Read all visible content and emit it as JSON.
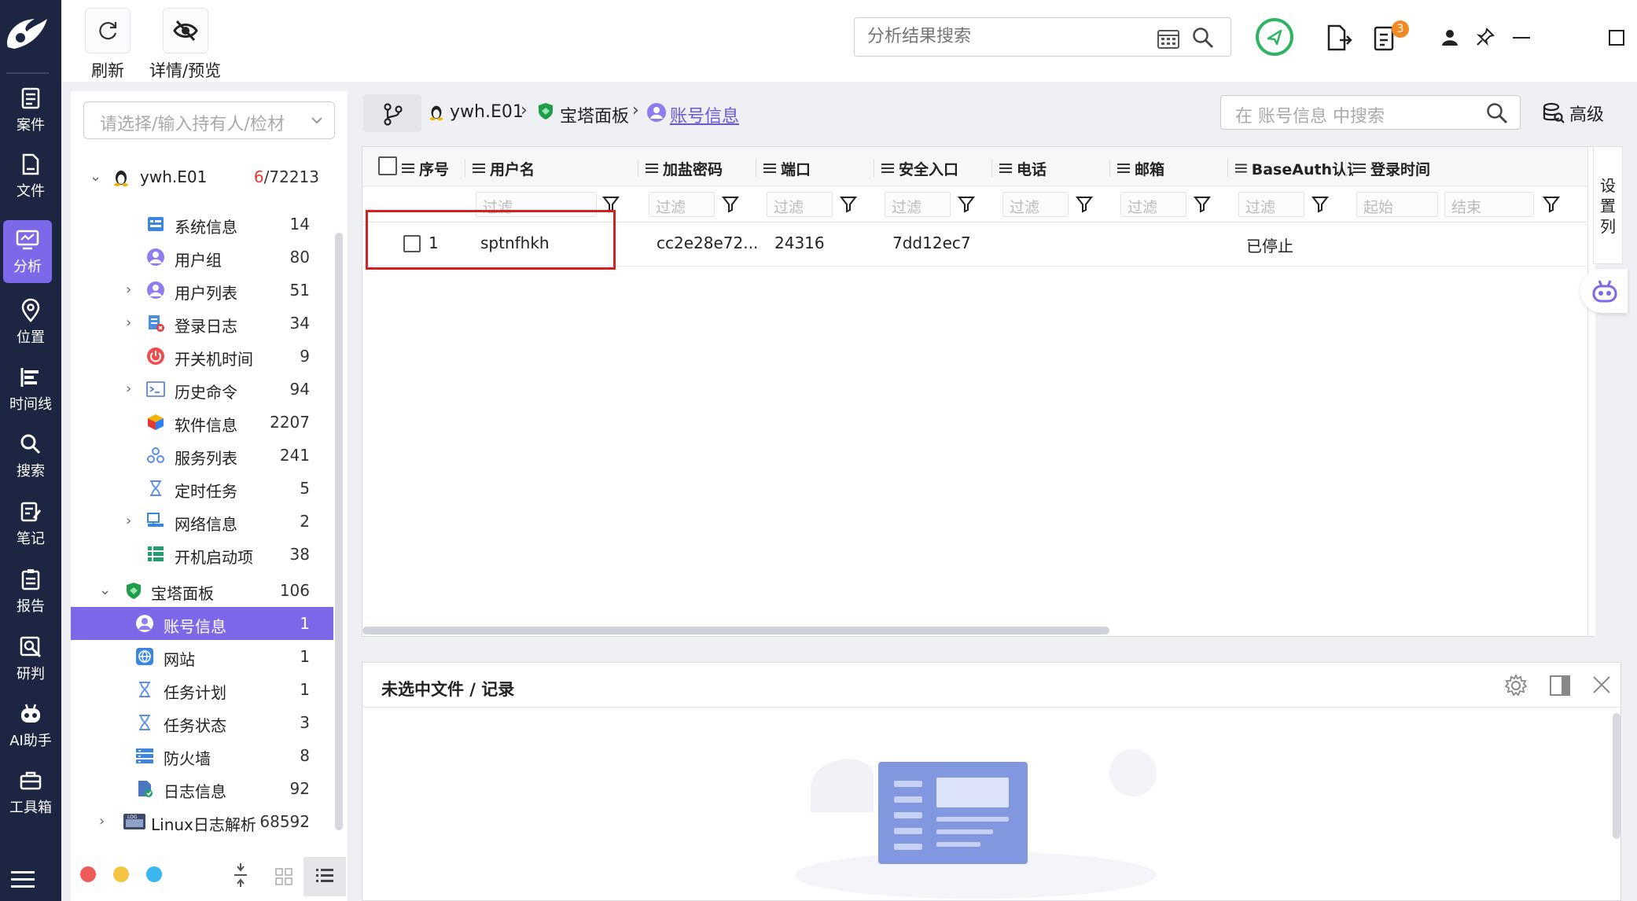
{
  "toolbar": {
    "refresh_label": "刷新",
    "details_label": "详情/预览",
    "search_placeholder": "分析结果搜索",
    "notification_count": "3"
  },
  "rail": {
    "items": [
      {
        "label": "案件",
        "icon": "case-icon"
      },
      {
        "label": "文件",
        "icon": "file-icon"
      },
      {
        "label": "分析",
        "icon": "analysis-icon"
      },
      {
        "label": "位置",
        "icon": "location-icon"
      },
      {
        "label": "时间线",
        "icon": "timeline-icon"
      },
      {
        "label": "搜索",
        "icon": "search-icon"
      },
      {
        "label": "笔记",
        "icon": "note-icon"
      },
      {
        "label": "报告",
        "icon": "report-icon"
      },
      {
        "label": "研判",
        "icon": "judge-icon"
      },
      {
        "label": "AI助手",
        "icon": "ai-icon"
      },
      {
        "label": "工具箱",
        "icon": "toolbox-icon"
      }
    ]
  },
  "left": {
    "owner_placeholder": "请选择/输入持有人/检材",
    "root": {
      "label": "ywh.E01",
      "count_a": "6",
      "count_b": "/72213"
    },
    "items": [
      {
        "label": "系统信息",
        "count": "14",
        "icon": "system-info-icon",
        "expandable": false
      },
      {
        "label": "用户组",
        "count": "80",
        "icon": "user-group-icon",
        "expandable": false
      },
      {
        "label": "用户列表",
        "count": "51",
        "icon": "user-list-icon",
        "expandable": true
      },
      {
        "label": "登录日志",
        "count": "34",
        "icon": "login-log-icon",
        "expandable": true
      },
      {
        "label": "开关机时间",
        "count": "9",
        "icon": "power-icon",
        "expandable": false
      },
      {
        "label": "历史命令",
        "count": "94",
        "icon": "terminal-icon",
        "expandable": true
      },
      {
        "label": "软件信息",
        "count": "2207",
        "icon": "software-icon",
        "expandable": false
      },
      {
        "label": "服务列表",
        "count": "241",
        "icon": "service-icon",
        "expandable": false
      },
      {
        "label": "定时任务",
        "count": "5",
        "icon": "hourglass-icon",
        "expandable": false
      },
      {
        "label": "网络信息",
        "count": "2",
        "icon": "network-icon",
        "expandable": true
      },
      {
        "label": "开机启动项",
        "count": "38",
        "icon": "startup-icon",
        "expandable": false
      }
    ],
    "bt_panel": {
      "label": "宝塔面板",
      "count": "106"
    },
    "bt_items": [
      {
        "label": "账号信息",
        "count": "1",
        "icon": "account-icon"
      },
      {
        "label": "网站",
        "count": "1",
        "icon": "website-icon"
      },
      {
        "label": "任务计划",
        "count": "1",
        "icon": "hourglass-icon"
      },
      {
        "label": "任务状态",
        "count": "3",
        "icon": "hourglass-icon"
      },
      {
        "label": "防火墙",
        "count": "8",
        "icon": "firewall-icon"
      },
      {
        "label": "日志信息",
        "count": "92",
        "icon": "log-icon"
      }
    ],
    "linux_log": {
      "label": "Linux日志解析",
      "count": "68592"
    }
  },
  "breadcrumb": {
    "items": [
      "ywh.E01",
      "宝塔面板",
      "账号信息"
    ],
    "search_placeholder": "在 账号信息 中搜索",
    "advanced_label": "高级"
  },
  "grid": {
    "columns": [
      "序号",
      "用户名",
      "加盐密码",
      "端口",
      "安全入口",
      "电话",
      "邮箱",
      "BaseAuth认证",
      "登录时间"
    ],
    "filter_placeholder": "过滤",
    "date_start": "起始",
    "date_end": "结束",
    "settings_label": "设置列",
    "rows": [
      {
        "index": "1",
        "username": "sptnfhkh",
        "password": "cc2e28e72...",
        "port": "24316",
        "entry": "7dd12ec7",
        "phone": "",
        "email": "",
        "baseauth": "已停止",
        "login_time": ""
      }
    ]
  },
  "detail": {
    "title": "未选中文件 / 记录"
  }
}
